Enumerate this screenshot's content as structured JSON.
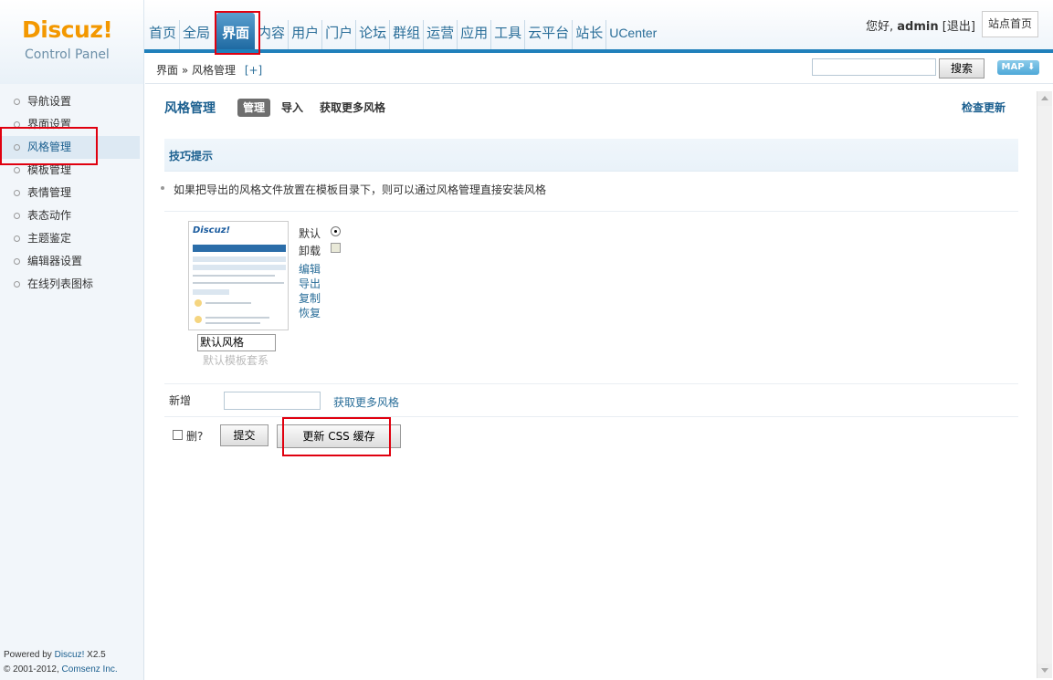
{
  "header": {
    "logo": {
      "brand": "Discuz!",
      "subtitle": "Control Panel"
    },
    "nav": [
      {
        "label": "首页"
      },
      {
        "label": "全局"
      },
      {
        "label": "界面",
        "active": true
      },
      {
        "label": "内容"
      },
      {
        "label": "用户"
      },
      {
        "label": "门户"
      },
      {
        "label": "论坛"
      },
      {
        "label": "群组"
      },
      {
        "label": "运营"
      },
      {
        "label": "应用"
      },
      {
        "label": "工具"
      },
      {
        "label": "云平台"
      },
      {
        "label": "站长"
      },
      {
        "label": "UCenter"
      }
    ],
    "greeting": "您好,",
    "username": "admin",
    "logout": "[退出]",
    "site_home": "站点首页"
  },
  "breadcrumb": {
    "path": "界面 » 风格管理",
    "add": "[+]"
  },
  "search": {
    "button": "搜索",
    "map": "MAP ⬇"
  },
  "sidebar": {
    "items": [
      {
        "label": "导航设置"
      },
      {
        "label": "界面设置"
      },
      {
        "label": "风格管理",
        "active": true
      },
      {
        "label": "模板管理"
      },
      {
        "label": "表情管理"
      },
      {
        "label": "表态动作"
      },
      {
        "label": "主题鉴定"
      },
      {
        "label": "编辑器设置"
      },
      {
        "label": "在线列表图标"
      }
    ],
    "powered_line1": "Powered by ",
    "powered_brand": "Discuz!",
    "powered_ver": " X2.5",
    "copyright": "© 2001-2012, ",
    "company": "Comsenz Inc."
  },
  "main": {
    "title": "风格管理",
    "tabs": [
      {
        "label": "管理",
        "active": true
      },
      {
        "label": "导入"
      },
      {
        "label": "获取更多风格"
      }
    ],
    "check_update": "检查更新",
    "tips_title": "技巧提示",
    "tip_text": "如果把导出的风格文件放置在模板目录下，则可以通过风格管理直接安装风格",
    "style": {
      "name": "默认风格",
      "subtitle": "默认模板套系",
      "thumb_logo": "Discuz!",
      "default_label": "默认",
      "uninstall_label": "卸载",
      "actions": [
        "编辑",
        "导出",
        "复制",
        "恢复"
      ]
    },
    "add_label": "新增",
    "add_more": "获取更多风格",
    "delete_label": "删?",
    "submit": "提交",
    "update_css": "更新 CSS 缓存"
  },
  "colors": {
    "accent": "#1b5f8f",
    "nav_active": "#2a7ab5",
    "highlight": "#e0000f",
    "logo_orange": "#f39800"
  }
}
